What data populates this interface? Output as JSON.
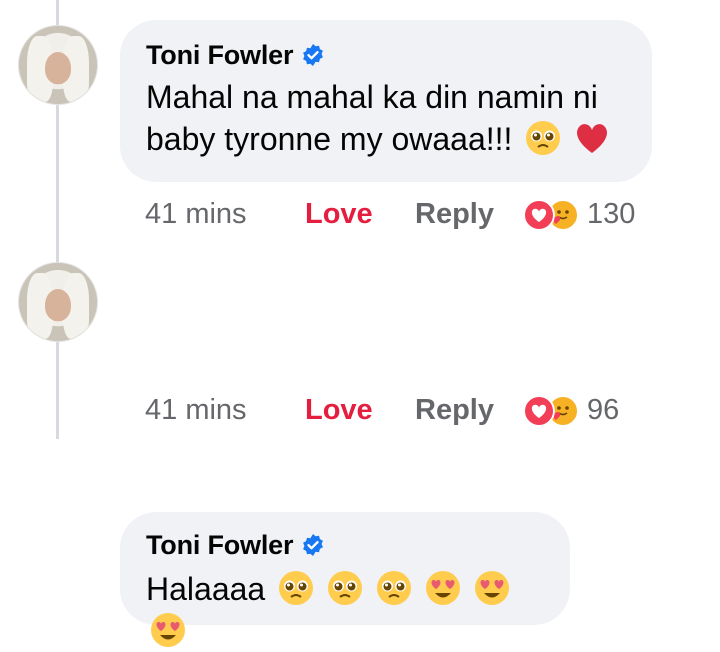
{
  "comments": [
    {
      "author": "Toni Fowler",
      "text": "Mahal na mahal ka din namin ni baby tyronne my owaaa!!!",
      "time": "41 mins",
      "love_label": "Love",
      "reply_label": "Reply",
      "reaction_count": "130",
      "emojis": [
        "pleading-face-emoji",
        "red-heart-emoji"
      ]
    },
    {
      "author": "Toni Fowler",
      "text": "Halaaaa",
      "time": "41 mins",
      "love_label": "Love",
      "reply_label": "Reply",
      "reaction_count": "96",
      "emojis": [
        "pleading-face-emoji",
        "pleading-face-emoji",
        "pleading-face-emoji",
        "heart-eyes-emoji",
        "heart-eyes-emoji",
        "heart-eyes-emoji"
      ]
    }
  ],
  "colors": {
    "bubble": "#f0f2f5",
    "love": "#e41e3f",
    "meta": "#65676b",
    "verified": "#1877f2"
  },
  "icons": [
    "verified-badge-icon",
    "love-reaction-icon",
    "care-reaction-icon"
  ]
}
